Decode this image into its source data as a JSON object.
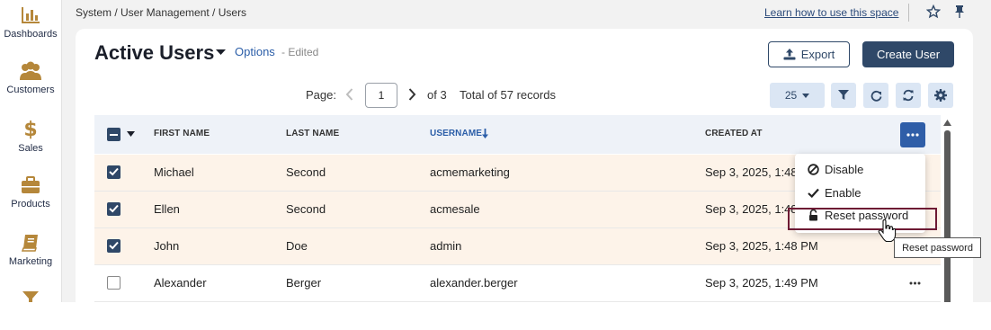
{
  "sidebar": {
    "items": [
      {
        "label": "Dashboards",
        "icon": "bar-chart-icon"
      },
      {
        "label": "Customers",
        "icon": "users-icon"
      },
      {
        "label": "Sales",
        "icon": "dollar-icon"
      },
      {
        "label": "Products",
        "icon": "briefcase-icon"
      },
      {
        "label": "Marketing",
        "icon": "book-icon"
      }
    ]
  },
  "topbar": {
    "breadcrumb": "System / User Management / Users",
    "learn_link": "Learn how to use this space"
  },
  "header": {
    "title": "Active Users",
    "options_link": "Options",
    "edited_label": "- Edited",
    "export_label": "Export",
    "create_label": "Create User"
  },
  "pager": {
    "page_label": "Page:",
    "page_value": "1",
    "of_label": "of 3",
    "total_label": "Total of 57 records",
    "per_page": "25"
  },
  "table": {
    "columns": [
      "FIRST NAME",
      "LAST NAME",
      "USERNAME",
      "CREATED AT"
    ],
    "sorted_column": "USERNAME",
    "rows": [
      {
        "first": "Michael",
        "last": "Second",
        "username": "acmemarketing",
        "created": "Sep 3, 2025, 1:48",
        "selected": true
      },
      {
        "first": "Ellen",
        "last": "Second",
        "username": "acmesale",
        "created": "Sep 3, 2025, 1:48",
        "selected": true
      },
      {
        "first": "John",
        "last": "Doe",
        "username": "admin",
        "created": "Sep 3, 2025, 1:48 PM",
        "selected": true
      },
      {
        "first": "Alexander",
        "last": "Berger",
        "username": "alexander.berger",
        "created": "Sep 3, 2025, 1:49 PM",
        "selected": false
      }
    ]
  },
  "menu": {
    "items": [
      "Disable",
      "Enable",
      "Reset password"
    ],
    "tooltip": "Reset password"
  },
  "colors": {
    "primary": "#2f4868",
    "accent_blue": "#2b5ea8",
    "selected_row": "#fdf3e9",
    "sidebar_icon": "#b5873a",
    "highlight_border": "#6e1a34"
  }
}
